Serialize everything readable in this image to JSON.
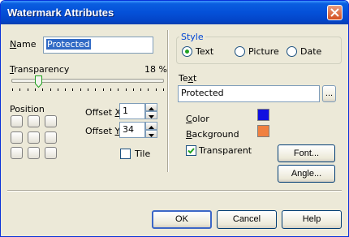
{
  "window": {
    "title": "Watermark Attributes"
  },
  "name": {
    "label": "Name",
    "value": "Protected"
  },
  "transparency": {
    "label": "Transparency",
    "value_text": "18 %",
    "value": 0.18
  },
  "position": {
    "label": "Position"
  },
  "offset_x": {
    "label": "Offset X",
    "value": "1"
  },
  "offset_y": {
    "label": "Offset Y",
    "value": "34"
  },
  "tile": {
    "label": "Tile",
    "checked": false
  },
  "style": {
    "label": "Style",
    "options": [
      "Text",
      "Picture",
      "Date"
    ],
    "selected": "Text"
  },
  "text": {
    "label": "Text",
    "value": "Protected",
    "browse_label": "..."
  },
  "color": {
    "label": "Color",
    "value": "#1010e0"
  },
  "background": {
    "label": "Background",
    "value": "#f08040"
  },
  "transparent": {
    "label": "Transparent",
    "checked": true
  },
  "buttons": {
    "font": "Font...",
    "angle": "Angle...",
    "ok": "OK",
    "cancel": "Cancel",
    "help": "Help"
  }
}
